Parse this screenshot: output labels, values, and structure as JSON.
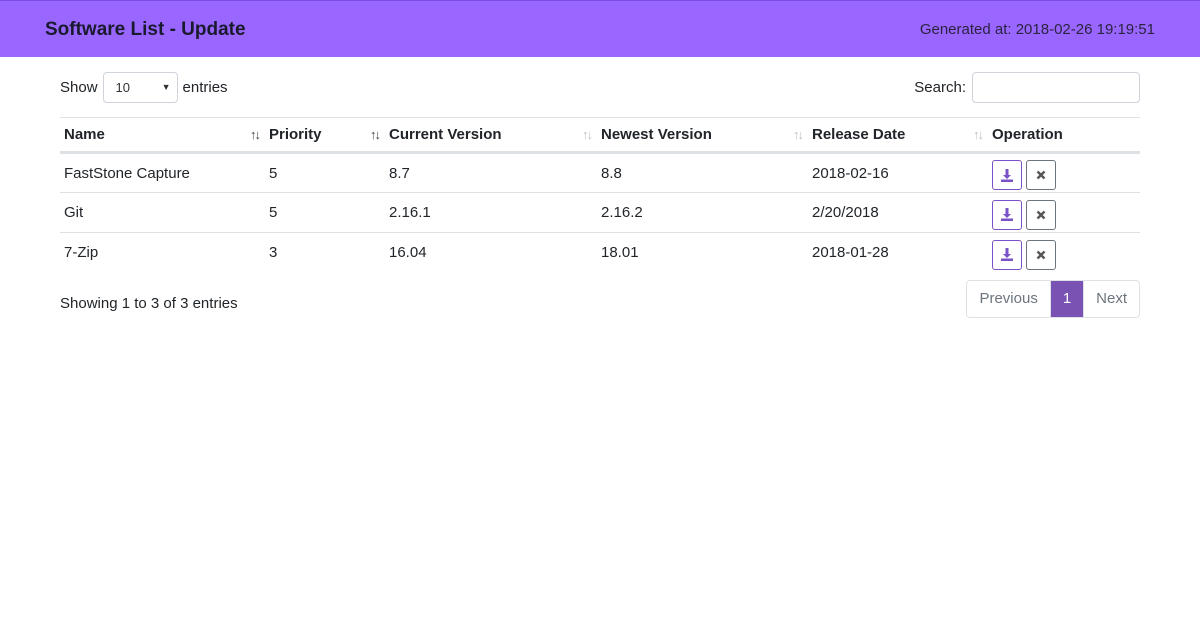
{
  "header": {
    "title": "Software List - Update",
    "generated": "Generated at: 2018-02-26 19:19:51"
  },
  "length_control": {
    "show_label": "Show",
    "selected": "10",
    "entries_label": "entries"
  },
  "search": {
    "label": "Search:",
    "value": ""
  },
  "table": {
    "columns": [
      "Name",
      "Priority",
      "Current Version",
      "Newest Version",
      "Release Date",
      "Operation"
    ],
    "sort_state": [
      "sortable",
      "descending",
      "sortable",
      "sortable",
      "sortable",
      "none"
    ],
    "rows": [
      [
        "FastStone Capture",
        "5",
        "8.7",
        "8.8",
        "2018-02-16"
      ],
      [
        "Git",
        "5",
        "2.16.1",
        "2.16.2",
        "2/20/2018"
      ],
      [
        "7-Zip",
        "3",
        "16.04",
        "18.01",
        "2018-01-28"
      ]
    ],
    "row_actions": [
      "download-icon",
      "close-icon"
    ]
  },
  "footer": {
    "info": "Showing 1 to 3 of 3 entries",
    "pagination": {
      "previous": "Previous",
      "current": "1",
      "next": "Next"
    }
  },
  "colors": {
    "navbar": "#9966ff",
    "accent": "#7952b3"
  }
}
